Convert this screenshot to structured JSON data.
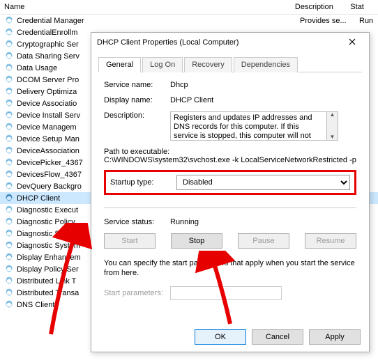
{
  "headers": {
    "name": "Name",
    "description": "Description",
    "status": "Stat"
  },
  "services": [
    {
      "label": "Credential Manager",
      "desc": "Provides se...",
      "stat": "Run"
    },
    {
      "label": "CredentialEnrollm"
    },
    {
      "label": "Cryptographic Ser"
    },
    {
      "label": "Data Sharing Serv"
    },
    {
      "label": "Data Usage"
    },
    {
      "label": "DCOM Server Pro"
    },
    {
      "label": "Delivery Optimiza"
    },
    {
      "label": "Device Associatio"
    },
    {
      "label": "Device Install Serv"
    },
    {
      "label": "Device Managem"
    },
    {
      "label": "Device Setup Man"
    },
    {
      "label": "DeviceAssociation"
    },
    {
      "label": "DevicePicker_4367"
    },
    {
      "label": "DevicesFlow_4367"
    },
    {
      "label": "DevQuery Backgro"
    },
    {
      "label": "DHCP Client",
      "selected": true
    },
    {
      "label": "Diagnostic Execut"
    },
    {
      "label": "Diagnostic Policy"
    },
    {
      "label": "Diagnostic Service"
    },
    {
      "label": "Diagnostic System"
    },
    {
      "label": "Display Enhancem"
    },
    {
      "label": "Display Policy Ser"
    },
    {
      "label": "Distributed Link T"
    },
    {
      "label": "Distributed Transa"
    },
    {
      "label": "DNS Client"
    }
  ],
  "dialog": {
    "title": "DHCP Client Properties (Local Computer)",
    "tabs": {
      "general": "General",
      "logon": "Log On",
      "recovery": "Recovery",
      "dependencies": "Dependencies"
    },
    "svc_name_lbl": "Service name:",
    "svc_name_val": "Dhcp",
    "disp_name_lbl": "Display name:",
    "disp_name_val": "DHCP Client",
    "desc_lbl": "Description:",
    "desc_val": "Registers and updates IP addresses and DNS records for this computer. If this service is stopped, this computer will not receive dynamic IP addresses",
    "path_lbl": "Path to executable:",
    "path_val": "C:\\WINDOWS\\system32\\svchost.exe -k LocalServiceNetworkRestricted -p",
    "startup_lbl": "Startup type:",
    "startup_val": "Disabled",
    "status_lbl": "Service status:",
    "status_val": "Running",
    "btn_start": "Start",
    "btn_stop": "Stop",
    "btn_pause": "Pause",
    "btn_resume": "Resume",
    "specify_text": "You can specify the start parameters that apply when you start the service from here.",
    "sp_lbl": "Start parameters:",
    "ok": "OK",
    "cancel": "Cancel",
    "apply": "Apply"
  }
}
